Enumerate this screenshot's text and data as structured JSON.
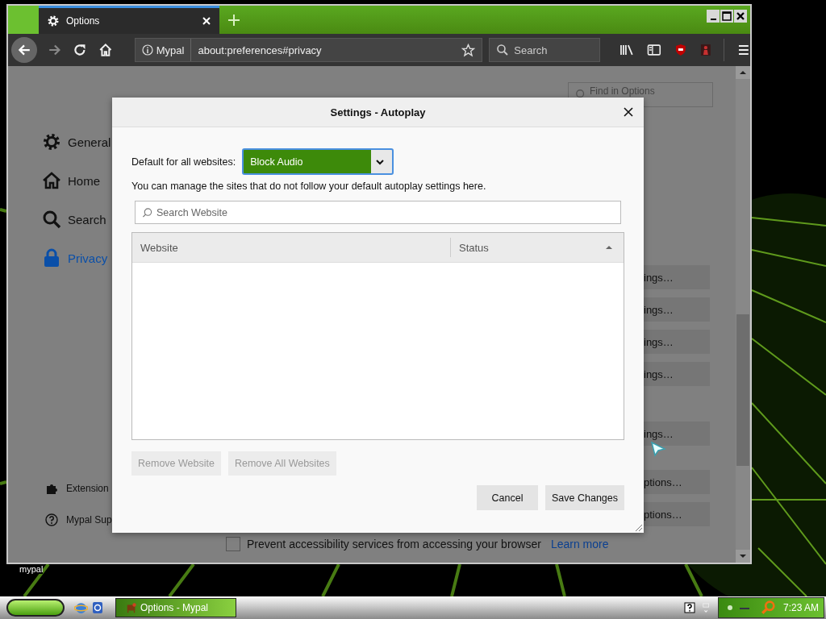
{
  "desktop": {
    "icon_label": "mypal"
  },
  "browser": {
    "tabs": [
      {
        "label": "Options",
        "selected": true
      }
    ],
    "identity": "Mypal",
    "url": "about:preferences#privacy",
    "search_placeholder": "Search",
    "find_placeholder": "Find in Options",
    "sidebar": [
      {
        "label": "General",
        "kind": "gear",
        "selected": false
      },
      {
        "label": "Home",
        "kind": "home",
        "selected": false
      },
      {
        "label": "Search",
        "kind": "search",
        "selected": false
      },
      {
        "label": "Privacy",
        "kind": "lock",
        "selected": true
      }
    ],
    "sidebar_footer": [
      {
        "label": "Extension",
        "kind": "puzzle"
      },
      {
        "label": "Mypal Sup",
        "kind": "help"
      }
    ],
    "button_groups": [
      [
        "ings…",
        "ings…",
        "ings…",
        "ings…"
      ],
      [
        "ings…"
      ],
      [
        "ptions…",
        "ptions…"
      ]
    ],
    "checkbox": {
      "label": "Prevent accessibility services from accessing your browser",
      "checked": false,
      "link": "Learn more"
    }
  },
  "dialog": {
    "title": "Settings - Autoplay",
    "default_label": "Default for all websites:",
    "select": {
      "value": "Block Audio",
      "focused": true
    },
    "description": "You can manage the sites that do not follow your default autoplay settings here.",
    "search_placeholder": "Search Website",
    "columns": [
      {
        "label": "Website",
        "sorted": false
      },
      {
        "label": "Status",
        "sorted": true
      }
    ],
    "list_buttons": [
      {
        "label": "Remove Website",
        "disabled": true
      },
      {
        "label": "Remove All Websites",
        "disabled": true
      }
    ],
    "footer_buttons": [
      {
        "label": "Cancel",
        "disabled": false
      },
      {
        "label": "Save Changes",
        "disabled": false
      }
    ]
  },
  "taskbar": {
    "tasks": [
      {
        "label": "Options - Mypal",
        "selected": true
      }
    ],
    "clock": "7:23 AM"
  }
}
